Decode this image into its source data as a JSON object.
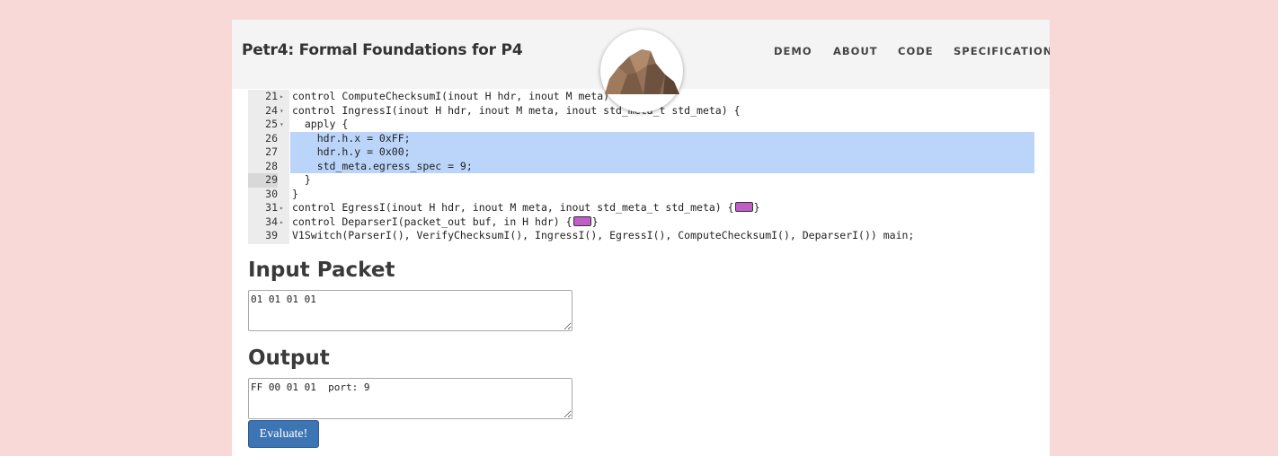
{
  "header": {
    "title": "Petr4: Formal Foundations for P4",
    "nav": [
      "DEMO",
      "ABOUT",
      "CODE",
      "SPECIFICATION"
    ]
  },
  "editor": {
    "lines": [
      {
        "num": "21",
        "fold": "▸",
        "text": "control ComputeChecksumI(inout H hdr, inout M meta) {"
      },
      {
        "num": "24",
        "fold": "▾",
        "text": "control IngressI(inout H hdr, inout M meta, inout std_meta_t std_meta) {"
      },
      {
        "num": "25",
        "fold": "▾",
        "text": "  apply {"
      },
      {
        "num": "26",
        "fold": "",
        "text": "    hdr.h.x = 0xFF;"
      },
      {
        "num": "27",
        "fold": "",
        "text": "    hdr.h.y = 0x00;"
      },
      {
        "num": "28",
        "fold": "",
        "text": "    std_meta.egress_spec = 9;"
      },
      {
        "num": "29",
        "fold": "",
        "text": "  }"
      },
      {
        "num": "30",
        "fold": "",
        "text": "}"
      },
      {
        "num": "31",
        "fold": "▸",
        "text": "control EgressI(inout H hdr, inout M meta, inout std_meta_t std_meta) {"
      },
      {
        "num": "34",
        "fold": "▸",
        "text": "control DeparserI(packet_out buf, in H hdr) {"
      },
      {
        "num": "39",
        "fold": "",
        "text": "V1Switch(ParserI(), VerifyChecksumI(), IngressI(), EgressI(), ComputeChecksumI(), DeparserI()) main;"
      }
    ],
    "highlight_color": "#bbd5fa",
    "fold_marker_color": "#c05ec8"
  },
  "input_section": {
    "heading": "Input Packet",
    "value": "01 01 01 01"
  },
  "output_section": {
    "heading": "Output",
    "value": "FF 00 01 01  port: 9"
  },
  "evaluate_button": {
    "label": "Evaluate!"
  },
  "colors": {
    "background": "#f8d9d7",
    "header_bg": "#f4f4f4",
    "button": "#3c74b4"
  }
}
